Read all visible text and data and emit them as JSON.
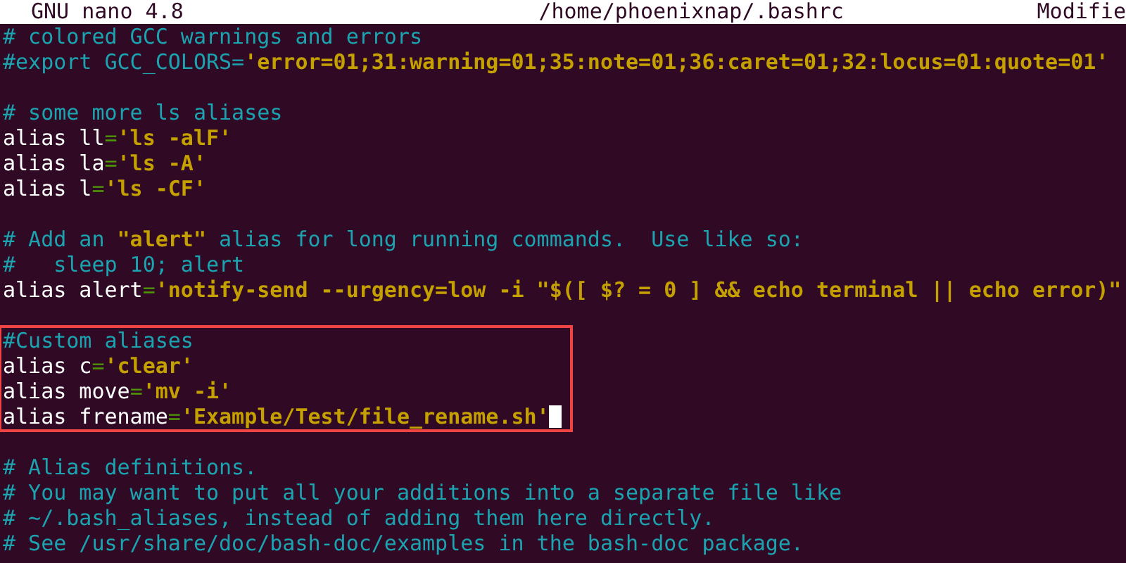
{
  "header": {
    "app": "GNU nano 4.8",
    "file": "/home/phoenixnap/.bashrc",
    "status": "Modifie"
  },
  "blocks": [
    {
      "highlighted": false,
      "lines": [
        {
          "cursor": false,
          "segments": [
            {
              "kind": "comment",
              "text": "# colored GCC warnings and errors"
            }
          ]
        },
        {
          "cursor": false,
          "segments": [
            {
              "kind": "comment",
              "text": "#export GCC_COLORS="
            },
            {
              "kind": "string",
              "text": "'error=01;31:warning=01;35:note=01;36:caret=01;32:locus=01:quote=01'"
            }
          ]
        }
      ]
    },
    {
      "highlighted": false,
      "lines": [
        {
          "cursor": false,
          "segments": [
            {
              "kind": "comment",
              "text": "# some more ls aliases"
            }
          ]
        },
        {
          "cursor": false,
          "segments": [
            {
              "kind": "plain",
              "text": "alias ll"
            },
            {
              "kind": "operator",
              "text": "="
            },
            {
              "kind": "string",
              "text": "'ls -alF'"
            }
          ]
        },
        {
          "cursor": false,
          "segments": [
            {
              "kind": "plain",
              "text": "alias la"
            },
            {
              "kind": "operator",
              "text": "="
            },
            {
              "kind": "string",
              "text": "'ls -A'"
            }
          ]
        },
        {
          "cursor": false,
          "segments": [
            {
              "kind": "plain",
              "text": "alias l"
            },
            {
              "kind": "operator",
              "text": "="
            },
            {
              "kind": "string",
              "text": "'ls -CF'"
            }
          ]
        }
      ]
    },
    {
      "highlighted": false,
      "lines": [
        {
          "cursor": false,
          "segments": [
            {
              "kind": "comment",
              "text": "# Add an "
            },
            {
              "kind": "string",
              "text": "\"alert\""
            },
            {
              "kind": "comment",
              "text": " alias for long running commands.  Use like so:"
            }
          ]
        },
        {
          "cursor": false,
          "segments": [
            {
              "kind": "comment",
              "text": "#   sleep 10; alert"
            }
          ]
        },
        {
          "cursor": false,
          "segments": [
            {
              "kind": "plain",
              "text": "alias alert"
            },
            {
              "kind": "operator",
              "text": "="
            },
            {
              "kind": "string",
              "text": "'notify-send --urgency=low -i \"$([ $? = 0 ] && echo terminal || echo error)\""
            }
          ]
        }
      ]
    },
    {
      "highlighted": true,
      "lines": [
        {
          "cursor": false,
          "segments": [
            {
              "kind": "comment",
              "text": "#Custom aliases"
            }
          ]
        },
        {
          "cursor": false,
          "segments": [
            {
              "kind": "plain",
              "text": "alias c"
            },
            {
              "kind": "operator",
              "text": "="
            },
            {
              "kind": "string",
              "text": "'clear'"
            }
          ]
        },
        {
          "cursor": false,
          "segments": [
            {
              "kind": "plain",
              "text": "alias move"
            },
            {
              "kind": "operator",
              "text": "="
            },
            {
              "kind": "string",
              "text": "'mv -i'"
            }
          ]
        },
        {
          "cursor": true,
          "segments": [
            {
              "kind": "plain",
              "text": "alias frename"
            },
            {
              "kind": "operator",
              "text": "="
            },
            {
              "kind": "string",
              "text": "'Example/Test/file_rename.sh'"
            }
          ]
        }
      ]
    },
    {
      "highlighted": false,
      "lines": [
        {
          "cursor": false,
          "segments": [
            {
              "kind": "comment",
              "text": "# Alias definitions."
            }
          ]
        },
        {
          "cursor": false,
          "segments": [
            {
              "kind": "comment",
              "text": "# You may want to put all your additions into a separate file like"
            }
          ]
        },
        {
          "cursor": false,
          "segments": [
            {
              "kind": "comment",
              "text": "# ~/.bash_aliases, instead of adding them here directly."
            }
          ]
        },
        {
          "cursor": false,
          "segments": [
            {
              "kind": "comment",
              "text": "# See /usr/share/doc/bash-doc/examples in the bash-doc package."
            }
          ]
        }
      ]
    }
  ]
}
